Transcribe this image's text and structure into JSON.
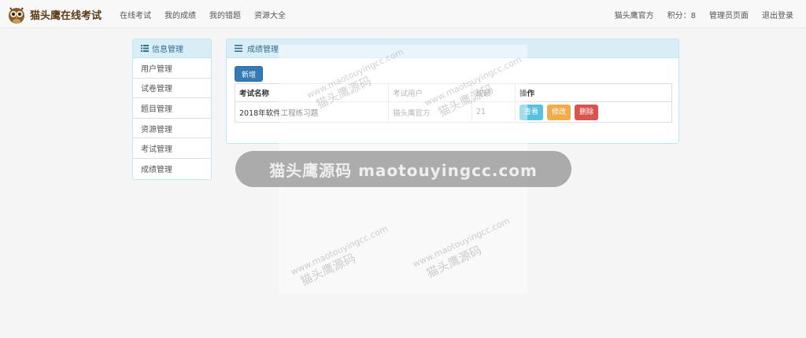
{
  "brand": {
    "title": "猫头鹰在线考试",
    "logo_icon": "owl-icon"
  },
  "nav": {
    "left": [
      "在线考试",
      "我的成绩",
      "我的错题",
      "资源大全"
    ],
    "right": [
      "猫头鹰官方",
      "积分：8",
      "管理员页面",
      "退出登录"
    ]
  },
  "sidebar": {
    "title": "信息管理",
    "icon": "list-icon",
    "items": [
      "用户管理",
      "试卷管理",
      "题目管理",
      "资源管理",
      "考试管理",
      "成绩管理"
    ]
  },
  "panel": {
    "title": "成绩管理",
    "icon": "list-icon",
    "add_label": "新增",
    "table": {
      "headers": [
        "考试名称",
        "考试用户",
        "成绩",
        "操作"
      ],
      "rows": [
        {
          "name": "2018年软件工程练习题",
          "user": "猫头鹰官方",
          "score": "21",
          "actions": [
            "查看",
            "修改",
            "删除"
          ]
        }
      ]
    }
  },
  "watermark": {
    "url": "www.maotouyingcc.com",
    "cn": "猫头鹰源码",
    "bar": "猫头鹰源码 maotouyingcc.com"
  },
  "colors": {
    "primary": "#337ab7",
    "info": "#5bc0de",
    "warning": "#f0ad4e",
    "danger": "#d9534f",
    "panel_head": "#d9edf7"
  }
}
